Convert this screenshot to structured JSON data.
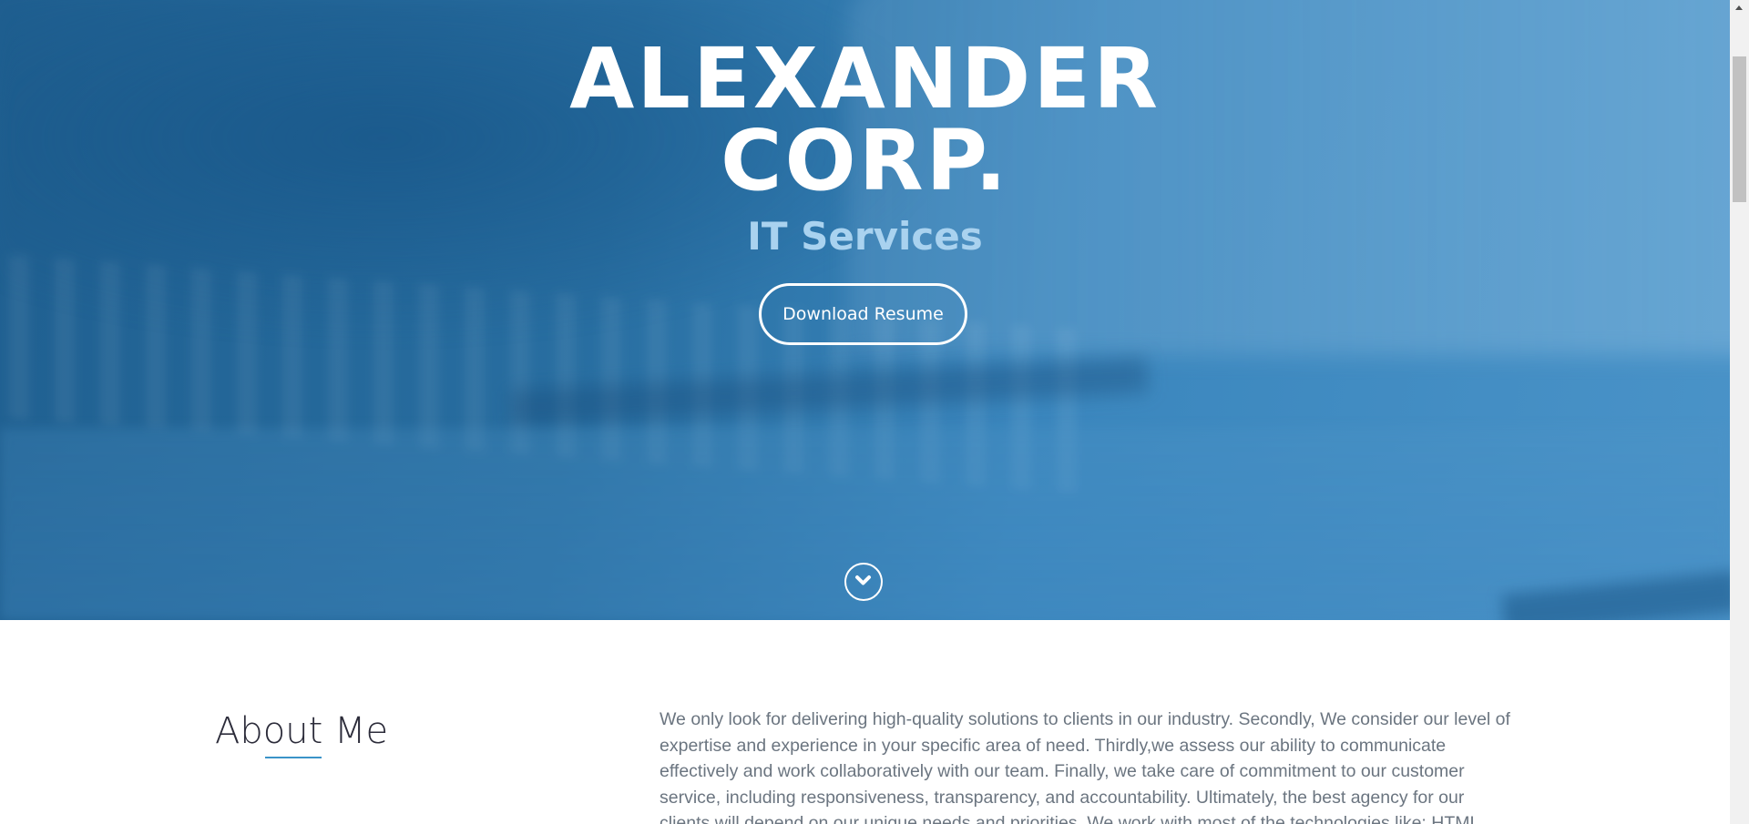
{
  "hero": {
    "title_line1": "ALEXANDER",
    "title_line2": "CORP.",
    "subtitle": "IT Services",
    "button_label": "Download Resume",
    "scroll_icon": "chevron-down-circle-icon",
    "colors": {
      "background_dark": "#1f5f90",
      "background_light": "#4a93c8",
      "subtitle": "#a9d2ef",
      "text": "#ffffff"
    }
  },
  "about": {
    "heading": "About Me",
    "accent_color": "#3a93c8",
    "body": "We only look for delivering high-quality solutions to clients in our industry. Secondly, We consider our level of expertise and experience in your specific area of need. Thirdly,we assess our ability to communicate effectively and work collaboratively with our team. Finally, we take care of commitment to our customer service, including responsiveness, transparency, and accountability. Ultimately, the best agency for our clients will depend on our unique needs and priorities. We work with most of the technologies like: HTML"
  },
  "scrollbar": {
    "up_icon": "scroll-up-arrow-icon"
  }
}
